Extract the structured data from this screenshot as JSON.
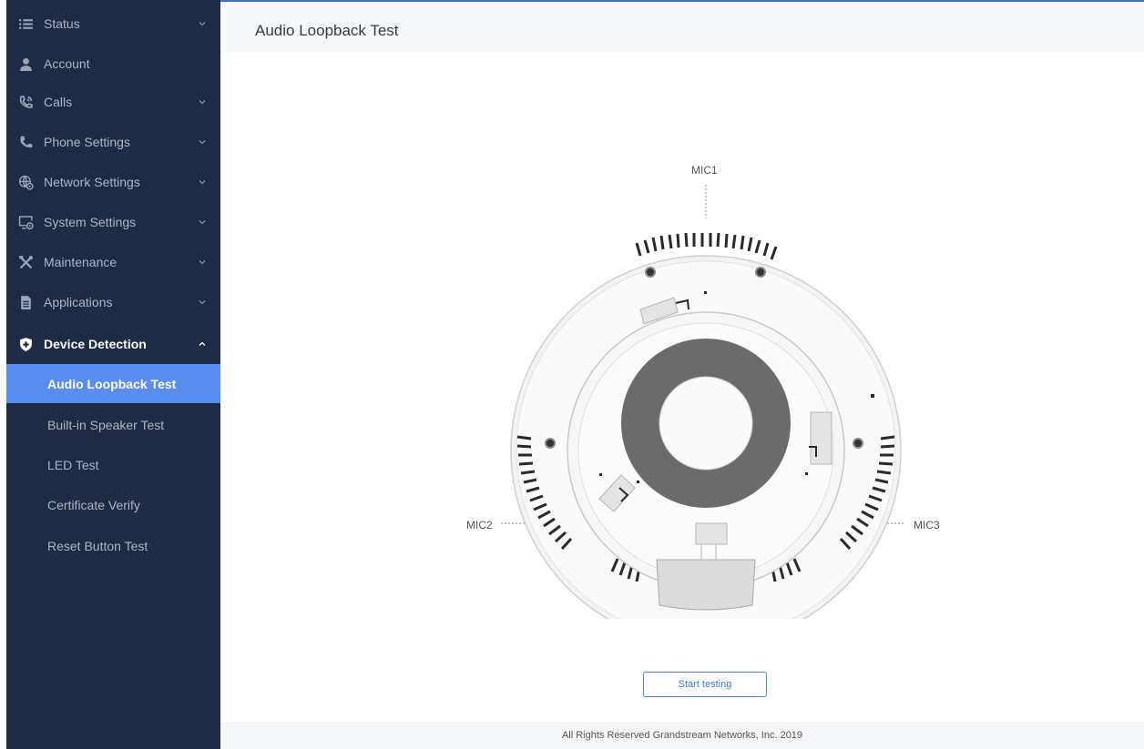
{
  "sidebar": {
    "items": [
      {
        "label": "Status",
        "icon": "list-icon"
      },
      {
        "label": "Account",
        "icon": "user-icon"
      },
      {
        "label": "Calls",
        "icon": "phone-ringing-icon"
      },
      {
        "label": "Phone Settings",
        "icon": "phone-icon"
      },
      {
        "label": "Network Settings",
        "icon": "network-gear-icon"
      },
      {
        "label": "System Settings",
        "icon": "monitor-gear-icon"
      },
      {
        "label": "Maintenance",
        "icon": "tools-icon"
      },
      {
        "label": "Applications",
        "icon": "document-icon"
      },
      {
        "label": "Device Detection",
        "icon": "shield-icon"
      }
    ],
    "subitems": [
      {
        "label": "Audio Loopback Test"
      },
      {
        "label": "Built-in Speaker Test"
      },
      {
        "label": "LED Test"
      },
      {
        "label": "Certificate Verify"
      },
      {
        "label": "Reset Button Test"
      }
    ]
  },
  "header": {
    "title": "Audio Loopback Test"
  },
  "device": {
    "mic1": "MIC1",
    "mic2": "MIC2",
    "mic3": "MIC3"
  },
  "actions": {
    "start": "Start testing"
  },
  "footer": {
    "text": "All Rights Reserved Grandstream Networks, Inc. 2019"
  },
  "colors": {
    "sidebar_bg": "#1f2a44",
    "active_bg": "#5b8def",
    "accent": "#3e78d1"
  }
}
